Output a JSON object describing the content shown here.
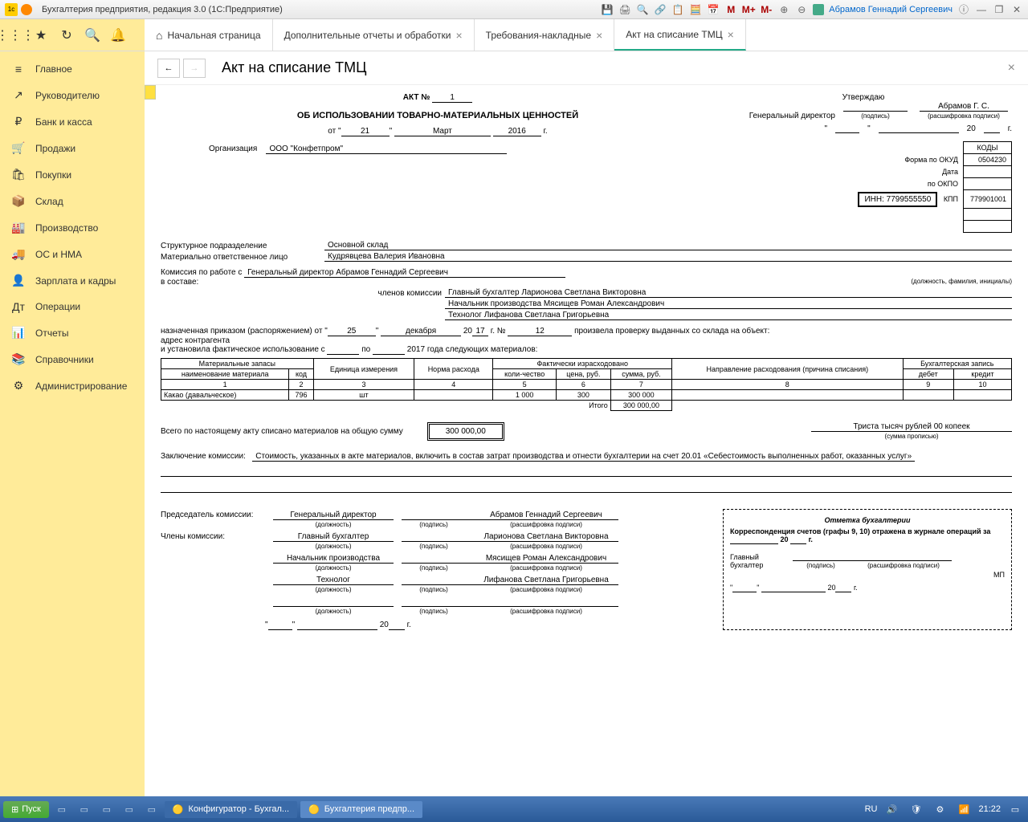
{
  "window": {
    "title": "Бухгалтерия предприятия, редакция 3.0  (1С:Предприятие)",
    "user": "Абрамов Геннадий Сергеевич"
  },
  "tabs": {
    "home": "Начальная страница",
    "t1": "Дополнительные отчеты и обработки",
    "t2": "Требования-накладные",
    "t3": "Акт на списание ТМЦ"
  },
  "sidebar": {
    "items": [
      {
        "icon": "≡",
        "label": "Главное"
      },
      {
        "icon": "↗",
        "label": "Руководителю"
      },
      {
        "icon": "₽",
        "label": "Банк и касса"
      },
      {
        "icon": "🛒",
        "label": "Продажи"
      },
      {
        "icon": "🛍",
        "label": "Покупки"
      },
      {
        "icon": "📦",
        "label": "Склад"
      },
      {
        "icon": "🏭",
        "label": "Производство"
      },
      {
        "icon": "🚚",
        "label": "ОС и НМА"
      },
      {
        "icon": "👤",
        "label": "Зарплата и кадры"
      },
      {
        "icon": "Дт",
        "label": "Операции"
      },
      {
        "icon": "📊",
        "label": "Отчеты"
      },
      {
        "icon": "📚",
        "label": "Справочники"
      },
      {
        "icon": "⚙",
        "label": "Администрирование"
      }
    ]
  },
  "page": {
    "title": "Акт на списание ТМЦ"
  },
  "doc": {
    "approve_label": "Утверждаю",
    "gendir_label": "Генеральный директор",
    "gendir_name": "Абрамов Г. С.",
    "sig_label": "(подпись)",
    "decode_label": "(расшифровка подписи)",
    "year_suffix": "г.",
    "quote": "\"",
    "twenty": "20",
    "underscore": "____",
    "act_label": "АКТ №",
    "act_no": "1",
    "subtitle": "ОБ ИСПОЛЬЗОВАНИИ ТОВАРНО-МАТЕРИАЛЬНЫХ ЦЕННОСТЕЙ",
    "from": "от",
    "day": "21",
    "month": "Март",
    "year": "2016",
    "org_label": "Организация",
    "org_name": "ООО \"Конфетпром\"",
    "codes_label": "КОДЫ",
    "okud_label": "Форма по ОКУД",
    "okud": "0504230",
    "date_label": "Дата",
    "okpo_label": "по ОКПО",
    "inn_label": "ИНН:",
    "inn": "7799555550",
    "kpp_label": "КПП",
    "kpp": "779901001",
    "struct_label": "Структурное подразделение",
    "struct": "Основной склад",
    "mol_label": "Материально ответственное лицо",
    "mol": "Кудрявцева Валерия Ивановна",
    "commission_label": "Комиссия по работе с",
    "commission_head": "Генеральный директор  Абрамов Геннадий Сергеевич",
    "position_hint": "(должность, фамилия, инициалы)",
    "in_composition": "в составе:",
    "members_label": "членов комиссии",
    "member1": "Главный бухгалтер  Ларионова Светлана Викторовна",
    "member2": "Начальник производства  Мясищев Роман Александрович",
    "member3": "Технолог Лифанова Светлана Григорьевна",
    "order_label": "назначенная приказом (распоряжением) от",
    "order_day": "25",
    "order_month": "декабря",
    "order_year": "17",
    "order_no_label": "г.  №",
    "order_no": "12",
    "check_text": "произвела проверку выданных со склада на объект:",
    "addr_label": "адрес контрагента",
    "usage_label": "и установила фактическое использование с",
    "usage_to": "по",
    "usage_year": "2017 года следующих материалов:",
    "th_mat": "Материальные запасы",
    "th_unit": "Единица измерения",
    "th_norm": "Норма расхода",
    "th_fact": "Фактически израсходовано",
    "th_dir": "Направление расходования (причина списания)",
    "th_acc": "Бухгалтерская запись",
    "th_name": "наименование материала",
    "th_code": "код",
    "th_qty": "коли-чество",
    "th_price": "цена, руб.",
    "th_sum": "сумма, руб.",
    "th_debit": "дебет",
    "th_credit": "кредит",
    "row": {
      "n1": "1",
      "n2": "2",
      "n3": "3",
      "n4": "4",
      "n5": "5",
      "n6": "6",
      "n7": "7",
      "n8": "8",
      "n9": "9",
      "n10": "10"
    },
    "data": {
      "name": "Какао (давальческое)",
      "code": "796",
      "unit": "шт",
      "qty": "1 000",
      "price": "300",
      "sum": "300 000"
    },
    "total_label": "Итого",
    "total": "300 000,00",
    "total_text": "Всего по настоящему акту списано материалов на общую сумму",
    "total_words": "Триста тысяч рублей 00 копеек",
    "words_hint": "(сумма прописью)",
    "conclusion_label": "Заключение комиссии:",
    "conclusion": "Стоимость, указанных в акте материалов, включить в состав затрат производства и отнести бухгалтерии на счет 20.01 «Себестоимость выполненных работ, оказанных услуг»",
    "chair_label": "Председатель комиссии:",
    "members_sig_label": "Члены комиссии:",
    "pos_gendir": "Генеральный директор",
    "pos_glavbuh": "Главный бухгалтер",
    "pos_nachprod": "Начальник производства",
    "pos_tech": "Технолог",
    "position_small": "(должность)",
    "name_abramov": "Абрамов Геннадий Сергеевич",
    "name_larionova": "Ларионова Светлана Викторовна",
    "name_myasischev": "Мясищев Роман Александрович",
    "name_lifanova": "Лифанова Светлана Григорьевна",
    "bookmark_title": "Отметка бухгалтерии",
    "bookmark_text": "Корреспонденция счетов (графы 9, 10) отражена в журнале операций за",
    "glav_buh": "Главный бухгалтер",
    "mp": "МП"
  },
  "taskbar": {
    "start": "Пуск",
    "task1": "Конфигуратор - Бухгал...",
    "task2": "Бухгалтерия предпр...",
    "lang": "RU",
    "time": "21:22"
  }
}
